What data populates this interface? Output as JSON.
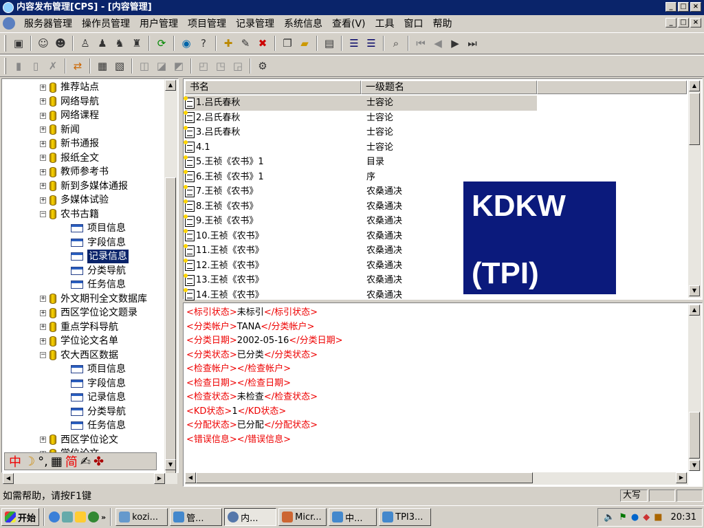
{
  "window": {
    "title": "内容发布管理[CPS] - [内容管理]"
  },
  "menu": [
    "服务器管理",
    "操作员管理",
    "用户管理",
    "项目管理",
    "记录管理",
    "系统信息",
    "查看(V)",
    "工具",
    "窗口",
    "帮助"
  ],
  "tree": [
    {
      "label": "推荐站点",
      "type": "db",
      "exp": "+"
    },
    {
      "label": "网络导航",
      "type": "db",
      "exp": "+"
    },
    {
      "label": "网络课程",
      "type": "db",
      "exp": "+"
    },
    {
      "label": "新闻",
      "type": "db",
      "exp": "+"
    },
    {
      "label": "新书通报",
      "type": "db",
      "exp": "+"
    },
    {
      "label": "报纸全文",
      "type": "db",
      "exp": "+"
    },
    {
      "label": "教师参考书",
      "type": "db",
      "exp": "+"
    },
    {
      "label": "新到多媒体通报",
      "type": "db",
      "exp": "+"
    },
    {
      "label": "多媒体试验",
      "type": "db",
      "exp": "+"
    },
    {
      "label": "农书古籍",
      "type": "db",
      "exp": "-"
    },
    {
      "label": "项目信息",
      "type": "rec"
    },
    {
      "label": "字段信息",
      "type": "rec"
    },
    {
      "label": "记录信息",
      "type": "rec",
      "selected": true
    },
    {
      "label": "分类导航",
      "type": "rec"
    },
    {
      "label": "任务信息",
      "type": "rec"
    },
    {
      "label": "外文期刊全文数据库",
      "type": "db",
      "exp": "+"
    },
    {
      "label": "西区学位论文题录",
      "type": "db",
      "exp": "+"
    },
    {
      "label": "重点学科导航",
      "type": "db",
      "exp": "+"
    },
    {
      "label": "学位论文名单",
      "type": "db",
      "exp": "+"
    },
    {
      "label": "农大西区数据",
      "type": "db",
      "exp": "-"
    },
    {
      "label": "项目信息",
      "type": "rec"
    },
    {
      "label": "字段信息",
      "type": "rec"
    },
    {
      "label": "记录信息",
      "type": "rec"
    },
    {
      "label": "分类导航",
      "type": "rec"
    },
    {
      "label": "任务信息",
      "type": "rec"
    },
    {
      "label": "西区学位论文",
      "type": "db",
      "exp": "+"
    },
    {
      "label": "学位论文",
      "type": "db",
      "exp": "+"
    }
  ],
  "ime": {
    "mode": "中",
    "sc": "简"
  },
  "list": {
    "col1": "书名",
    "col2": "一级题名",
    "rows": [
      [
        "1.吕氏春秋",
        "士容论"
      ],
      [
        "2.吕氏春秋",
        "士容论"
      ],
      [
        "3.吕氏春秋",
        "士容论"
      ],
      [
        "4.1",
        "士容论"
      ],
      [
        "5.王祯《农书》1",
        "目录"
      ],
      [
        "6.王祯《农书》1",
        "序"
      ],
      [
        "7.王祯《农书》",
        "农桑通决"
      ],
      [
        "8.王祯《农书》",
        "农桑通决"
      ],
      [
        "9.王祯《农书》",
        "农桑通决"
      ],
      [
        "10.王祯《农书》",
        "农桑通决"
      ],
      [
        "11.王祯《农书》",
        "农桑通决"
      ],
      [
        "12.王祯《农书》",
        "农桑通决"
      ],
      [
        "13.王祯《农书》",
        "农桑通决"
      ],
      [
        "14.王祯《农书》",
        "农桑通决"
      ]
    ]
  },
  "overlay": {
    "line1": "KDKW",
    "line2": "(TPI)"
  },
  "detail": [
    {
      "tag": "标引状态",
      "value": "未标引"
    },
    {
      "tag": "分类帐户",
      "value": "TANA"
    },
    {
      "tag": "分类日期",
      "value": "2002-05-16"
    },
    {
      "tag": "分类状态",
      "value": "已分类"
    },
    {
      "tag": "检查帐户",
      "value": ""
    },
    {
      "tag": "检查日期",
      "value": ""
    },
    {
      "tag": "检查状态",
      "value": "未检查"
    },
    {
      "tag": "KD状态",
      "value": "1"
    },
    {
      "tag": "分配状态",
      "value": "已分配"
    },
    {
      "tag": "错误信息",
      "value": ""
    }
  ],
  "status": {
    "help": "如需帮助，请按F1键",
    "caps": "大写"
  },
  "taskbar": {
    "start": "开始",
    "tasks": [
      "kozi...",
      "管...",
      "内...",
      "Micr...",
      "中...",
      "TPI3..."
    ],
    "clock": "20:31"
  }
}
